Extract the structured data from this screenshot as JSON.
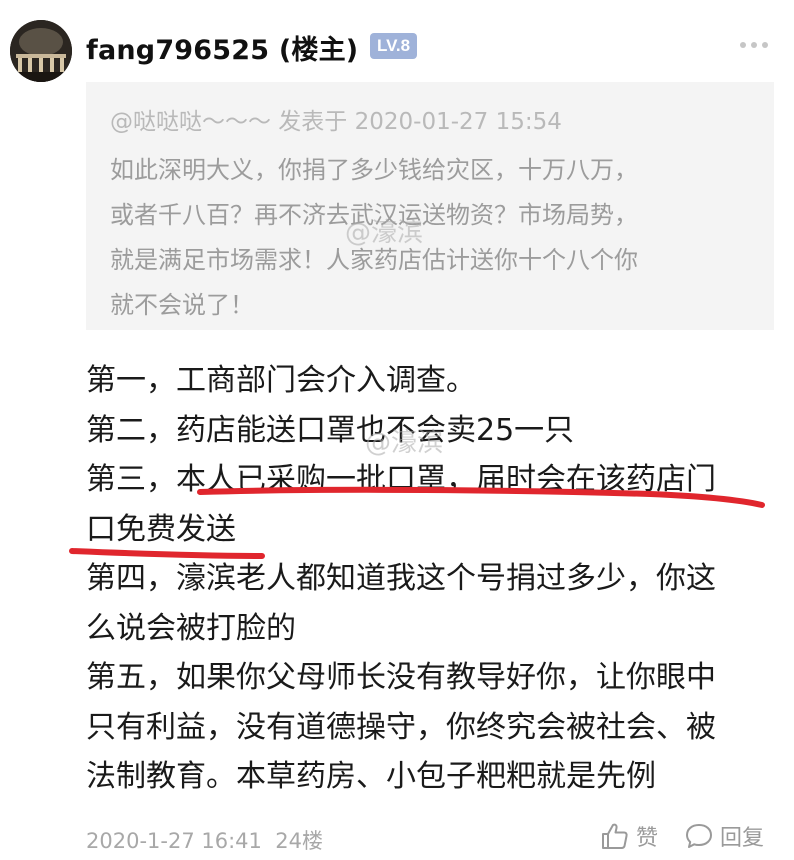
{
  "post": {
    "author": "fang796525 (楼主)",
    "level": "LV.8",
    "quote": {
      "meta": "@哒哒哒～～～ 发表于 2020-01-27 15:54",
      "lines": [
        "如此深明大义，你捐了多少钱给灾区，十万八万，",
        "或者千八百？再不济去武汉运送物资？市场局势，",
        "就是满足市场需求！人家药店估计送你十个八个你",
        "就不会说了！"
      ]
    },
    "body_lines": [
      "第一，工商部门会介入调查。",
      "第二，药店能送口罩也不会卖25一只",
      "第三，本人已采购一批口罩，届时会在该药店门",
      "口免费发送",
      "第四，濠滨老人都知道我这个号捐过多少，你这",
      "么说会被打脸的",
      "第五，如果你父母师长没有教导好你，让你眼中",
      "只有利益，没有道德操守，你终究会被社会、被",
      "法制教育。本草药房、小包子粑粑就是先例"
    ],
    "watermark": "@濠滨",
    "footer": {
      "timestamp": "2020-1-27 16:41",
      "floor": "24楼",
      "like_label": "赞",
      "reply_label": "回复"
    }
  },
  "colors": {
    "level_badge": "#9fb2d9",
    "underline": "#e0262d",
    "quote_background": "#f4f4f4"
  },
  "icons": [
    "avatar",
    "more-dots-icon",
    "thumbs-up-icon",
    "comment-bubble-icon"
  ]
}
